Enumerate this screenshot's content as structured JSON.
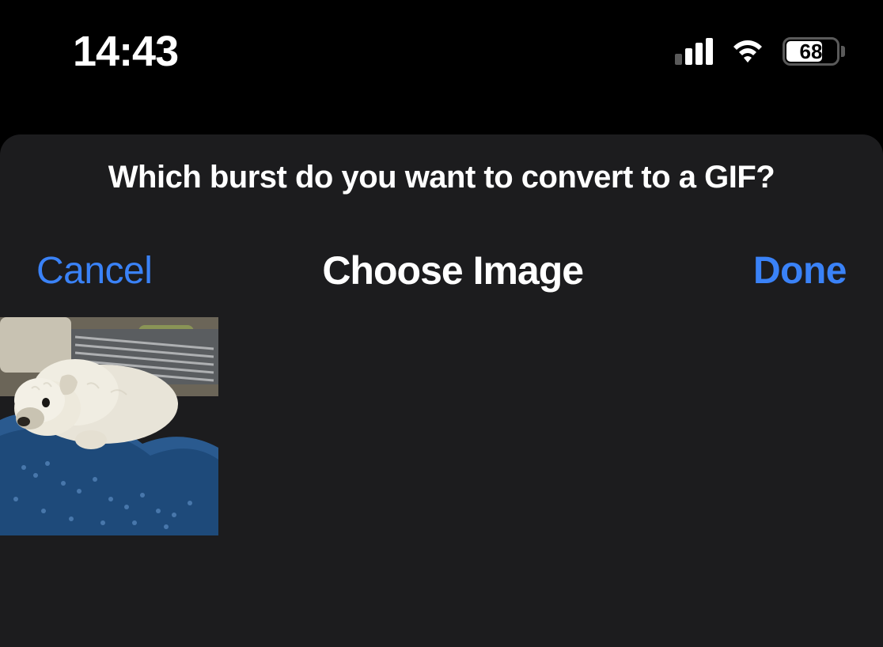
{
  "status_bar": {
    "time": "14:43",
    "battery_percent": "68",
    "cellular_bars": 3,
    "wifi_connected": true
  },
  "sheet": {
    "prompt": "Which burst do you want to convert to a GIF?",
    "nav": {
      "cancel_label": "Cancel",
      "title": "Choose Image",
      "done_label": "Done"
    },
    "photos": [
      {
        "alt": "White dog on blue patterned blanket"
      }
    ]
  },
  "colors": {
    "accent": "#3a82f7",
    "sheet_bg": "#1c1c1e"
  }
}
